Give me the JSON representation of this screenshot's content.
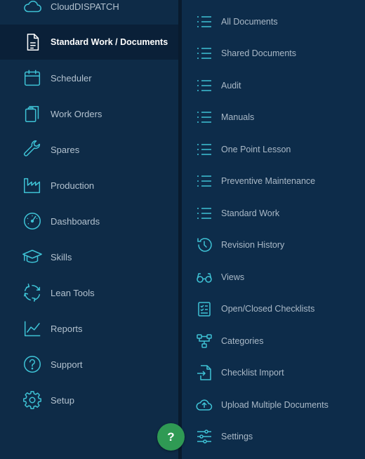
{
  "sidebar": {
    "items": [
      {
        "label": "CloudDISPATCH",
        "icon": "cloud-icon"
      },
      {
        "label": "Standard Work / Documents",
        "icon": "document-icon",
        "active": true
      },
      {
        "label": "Scheduler",
        "icon": "calendar-icon"
      },
      {
        "label": "Work Orders",
        "icon": "clipboard-icon"
      },
      {
        "label": "Spares",
        "icon": "wrench-icon"
      },
      {
        "label": "Production",
        "icon": "factory-icon"
      },
      {
        "label": "Dashboards",
        "icon": "gauge-icon"
      },
      {
        "label": "Skills",
        "icon": "graduation-cap-icon"
      },
      {
        "label": "Lean Tools",
        "icon": "cycle-icon"
      },
      {
        "label": "Reports",
        "icon": "line-chart-icon"
      },
      {
        "label": "Support",
        "icon": "question-circle-icon"
      },
      {
        "label": "Setup",
        "icon": "gear-icon"
      }
    ]
  },
  "submenu": {
    "items": [
      {
        "label": "All Documents",
        "icon": "list-icon"
      },
      {
        "label": "Shared Documents",
        "icon": "list-icon"
      },
      {
        "label": "Audit",
        "icon": "list-icon"
      },
      {
        "label": "Manuals",
        "icon": "list-icon"
      },
      {
        "label": "One Point Lesson",
        "icon": "list-icon"
      },
      {
        "label": "Preventive Maintenance",
        "icon": "list-icon"
      },
      {
        "label": "Standard Work",
        "icon": "list-icon"
      },
      {
        "label": "Revision History",
        "icon": "history-icon"
      },
      {
        "label": "Views",
        "icon": "glasses-icon"
      },
      {
        "label": "Open/Closed Checklists",
        "icon": "checklist-icon"
      },
      {
        "label": "Categories",
        "icon": "hierarchy-icon"
      },
      {
        "label": "Checklist Import",
        "icon": "file-import-icon"
      },
      {
        "label": "Upload Multiple Documents",
        "icon": "cloud-upload-icon"
      },
      {
        "label": "Settings",
        "icon": "sliders-icon"
      }
    ]
  },
  "help": {
    "label": "?"
  },
  "colors": {
    "accent": "#3ec2d5",
    "sidebar_bg": "#0e2b47",
    "active_bg": "#0a2038",
    "help_green": "#2f9a54"
  }
}
